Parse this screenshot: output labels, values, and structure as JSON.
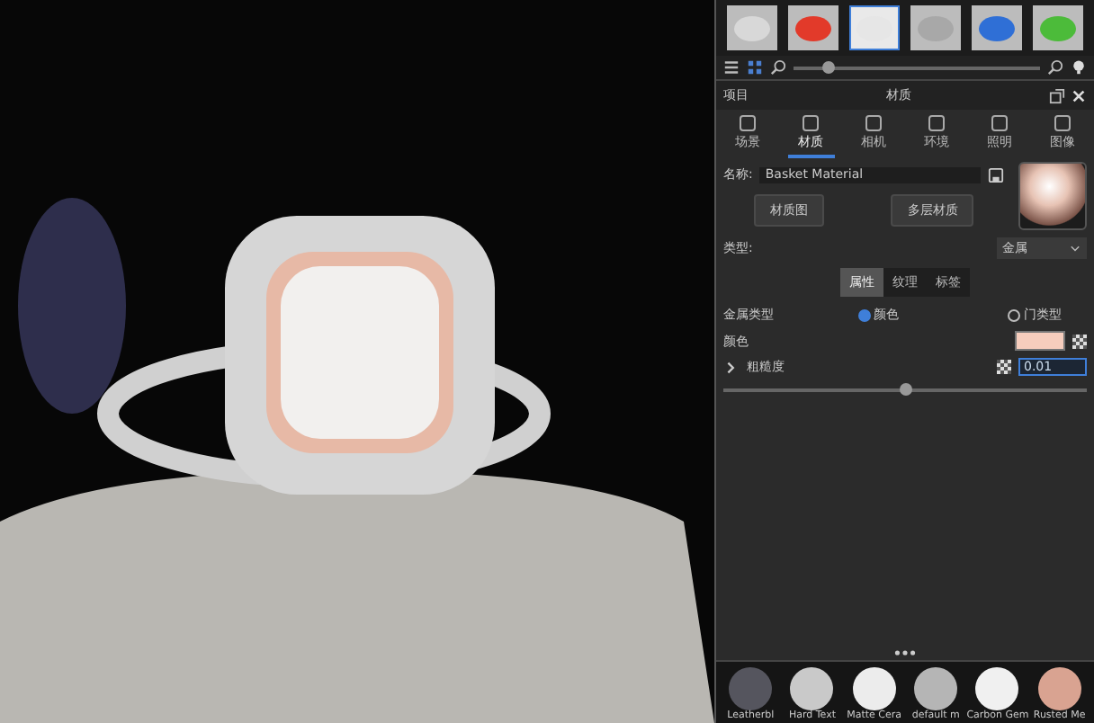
{
  "top_library": {
    "thumbnails": [
      {
        "color": "#d8d8d8",
        "selected": false
      },
      {
        "color": "#e23a2a",
        "selected": false
      },
      {
        "color": "#e6e6e6",
        "selected": true
      },
      {
        "color": "#a8a8a8",
        "selected": false
      },
      {
        "color": "#2f6fd6",
        "selected": false
      },
      {
        "color": "#4cbb3a",
        "selected": false
      }
    ],
    "zoom_slider": {
      "level": 0.14
    }
  },
  "panel": {
    "left_title": "项目",
    "title": "材质",
    "tabs": [
      {
        "label": "场景",
        "selected": false
      },
      {
        "label": "材质",
        "selected": true
      },
      {
        "label": "相机",
        "selected": false
      },
      {
        "label": "环境",
        "selected": false
      },
      {
        "label": "照明",
        "selected": false
      },
      {
        "label": "图像",
        "selected": false
      }
    ],
    "name_label": "名称:",
    "name_value": "Basket Material",
    "buttons": [
      "材质图",
      "多层材质"
    ],
    "type_label": "类型:",
    "type_value": "金属",
    "segments": [
      {
        "label": "属性",
        "selected": true
      },
      {
        "label": "纹理",
        "selected": false
      },
      {
        "label": "标签",
        "selected": false
      }
    ],
    "metal_type_label": "金属类型",
    "radios": [
      {
        "label": "颜色",
        "selected": true
      },
      {
        "label": "门类型",
        "selected": false
      }
    ],
    "color_label": "颜色",
    "roughness_label": "粗糙度",
    "roughness_value": "0.01",
    "roughness_slider": {
      "level": 0.5
    }
  },
  "bottom_library": {
    "materials": [
      {
        "label": "Leatherbl",
        "color": "#55555e"
      },
      {
        "label": "Hard Text",
        "color": "#c9c9c9"
      },
      {
        "label": "Matte Cera",
        "color": "#ececec"
      },
      {
        "label": "default m",
        "color": "#b5b5b5"
      },
      {
        "label": "Carbon Gem",
        "color": "#f0f0f0"
      },
      {
        "label": "Rusted Me",
        "color": "#d9a391"
      }
    ]
  }
}
